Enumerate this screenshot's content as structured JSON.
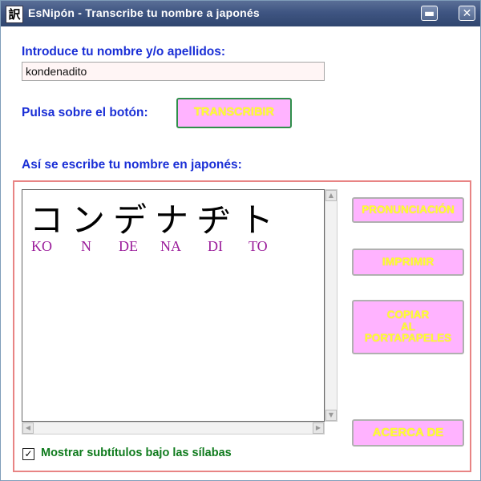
{
  "window": {
    "app_icon_glyph": "訳",
    "title": "EsNipón -  Transcribe tu nombre a japonés",
    "minimize_glyph": "▬",
    "close_glyph": "✕"
  },
  "form": {
    "name_label": "Introduce tu nombre y/o apellidos:",
    "name_value": "kondenadito",
    "press_label": "Pulsa sobre el botón:",
    "transcribe_button": "TRANSCRIBIR",
    "result_label": "Así se escribe tu nombre en japonés:"
  },
  "result": {
    "kana": [
      "コ",
      "ン",
      "デ",
      "ナ",
      "ヂ",
      "ト"
    ],
    "romaji": [
      "KO",
      "N",
      "DE",
      "NA",
      "DI",
      "TO"
    ]
  },
  "side_buttons": {
    "pronunciation": "PRONUNCIACIÓN",
    "print": "IMPRIMIR",
    "copy_line1": "COPIAR",
    "copy_line2": "AL",
    "copy_line3": "PORTAPAPELES",
    "about": "ACERCA DE"
  },
  "options": {
    "show_subtitles_label": "Mostrar subtítulos bajo las sílabas",
    "show_subtitles_checked": true,
    "check_glyph": "✓"
  },
  "colors": {
    "label_blue": "#1a2fd6",
    "button_pink": "#ffb3ff",
    "button_text_yellow": "#ffff33",
    "romaji_purple": "#9a1b9a",
    "group_border": "#e88484",
    "checkbox_label_green": "#0f7b1d"
  }
}
